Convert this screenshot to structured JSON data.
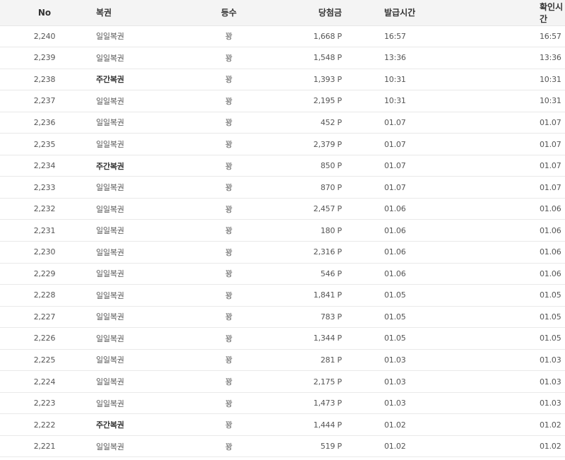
{
  "headers": {
    "no": "No",
    "type": "복권",
    "rank": "등수",
    "prize": "당첨금",
    "issued": "발급시간",
    "checked": "확인시간"
  },
  "rows": [
    {
      "no": "2,240",
      "type": "일일복권",
      "weekly": false,
      "rank": "꽝",
      "prize": "1,668 P",
      "issued": "16:57",
      "checked": "16:57"
    },
    {
      "no": "2,239",
      "type": "일일복권",
      "weekly": false,
      "rank": "꽝",
      "prize": "1,548 P",
      "issued": "13:36",
      "checked": "13:36"
    },
    {
      "no": "2,238",
      "type": "주간복권",
      "weekly": true,
      "rank": "꽝",
      "prize": "1,393 P",
      "issued": "10:31",
      "checked": "10:31"
    },
    {
      "no": "2,237",
      "type": "일일복권",
      "weekly": false,
      "rank": "꽝",
      "prize": "2,195 P",
      "issued": "10:31",
      "checked": "10:31"
    },
    {
      "no": "2,236",
      "type": "일일복권",
      "weekly": false,
      "rank": "꽝",
      "prize": "452 P",
      "issued": "01.07",
      "checked": "01.07"
    },
    {
      "no": "2,235",
      "type": "일일복권",
      "weekly": false,
      "rank": "꽝",
      "prize": "2,379 P",
      "issued": "01.07",
      "checked": "01.07"
    },
    {
      "no": "2,234",
      "type": "주간복권",
      "weekly": true,
      "rank": "꽝",
      "prize": "850 P",
      "issued": "01.07",
      "checked": "01.07"
    },
    {
      "no": "2,233",
      "type": "일일복권",
      "weekly": false,
      "rank": "꽝",
      "prize": "870 P",
      "issued": "01.07",
      "checked": "01.07"
    },
    {
      "no": "2,232",
      "type": "일일복권",
      "weekly": false,
      "rank": "꽝",
      "prize": "2,457 P",
      "issued": "01.06",
      "checked": "01.06"
    },
    {
      "no": "2,231",
      "type": "일일복권",
      "weekly": false,
      "rank": "꽝",
      "prize": "180 P",
      "issued": "01.06",
      "checked": "01.06"
    },
    {
      "no": "2,230",
      "type": "일일복권",
      "weekly": false,
      "rank": "꽝",
      "prize": "2,316 P",
      "issued": "01.06",
      "checked": "01.06"
    },
    {
      "no": "2,229",
      "type": "일일복권",
      "weekly": false,
      "rank": "꽝",
      "prize": "546 P",
      "issued": "01.06",
      "checked": "01.06"
    },
    {
      "no": "2,228",
      "type": "일일복권",
      "weekly": false,
      "rank": "꽝",
      "prize": "1,841 P",
      "issued": "01.05",
      "checked": "01.05"
    },
    {
      "no": "2,227",
      "type": "일일복권",
      "weekly": false,
      "rank": "꽝",
      "prize": "783 P",
      "issued": "01.05",
      "checked": "01.05"
    },
    {
      "no": "2,226",
      "type": "일일복권",
      "weekly": false,
      "rank": "꽝",
      "prize": "1,344 P",
      "issued": "01.05",
      "checked": "01.05"
    },
    {
      "no": "2,225",
      "type": "일일복권",
      "weekly": false,
      "rank": "꽝",
      "prize": "281 P",
      "issued": "01.03",
      "checked": "01.03"
    },
    {
      "no": "2,224",
      "type": "일일복권",
      "weekly": false,
      "rank": "꽝",
      "prize": "2,175 P",
      "issued": "01.03",
      "checked": "01.03"
    },
    {
      "no": "2,223",
      "type": "일일복권",
      "weekly": false,
      "rank": "꽝",
      "prize": "1,473 P",
      "issued": "01.03",
      "checked": "01.03"
    },
    {
      "no": "2,222",
      "type": "주간복권",
      "weekly": true,
      "rank": "꽝",
      "prize": "1,444 P",
      "issued": "01.02",
      "checked": "01.02"
    },
    {
      "no": "2,221",
      "type": "일일복권",
      "weekly": false,
      "rank": "꽝",
      "prize": "519 P",
      "issued": "01.02",
      "checked": "01.02"
    }
  ]
}
